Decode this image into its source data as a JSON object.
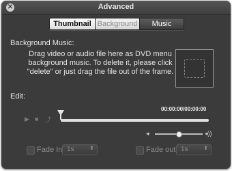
{
  "window": {
    "title": "Advanced"
  },
  "tabs": [
    {
      "label": "Thumbnail"
    },
    {
      "label": "Background"
    },
    {
      "label": "Music"
    }
  ],
  "background_music": {
    "heading": "Background Music:",
    "description": "Drag video or audio file here as DVD menu background music. To delete it, please click \"delete\" or just drag the file out of the frame."
  },
  "edit": {
    "heading": "Edit:",
    "timecode": "00:00:00/00:00:00",
    "controls": {
      "play_icon": "▶",
      "stop_icon": "■",
      "export_icon": "⤴"
    },
    "volume": {
      "level": 0.5,
      "low_icon": "◂",
      "high_icon": "◂))"
    }
  },
  "fade_in": {
    "label": "Fade In:",
    "value": "1s",
    "checked": false
  },
  "fade_out": {
    "label": "Fade out:",
    "value": "1s",
    "checked": false
  }
}
